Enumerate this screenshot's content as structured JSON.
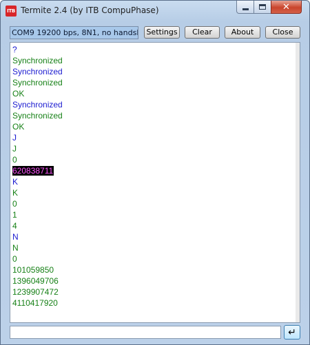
{
  "window": {
    "title": "Termite 2.4 (by ITB CompuPhase)",
    "icon_text": "ITB"
  },
  "titlebar_buttons": {
    "minimize_icon": "minimize-icon",
    "maximize_icon": "maximize-icon",
    "close_icon": "close-icon",
    "close_glyph": "✕"
  },
  "toolbar": {
    "port_status": "COM9 19200 bps, 8N1, no handshake",
    "settings_label": "Settings",
    "clear_label": "Clear",
    "about_label": "About",
    "close_label": "Close"
  },
  "colors": {
    "green": "#168016",
    "blue": "#1a1ad0",
    "highlight_bg": "#000000",
    "highlight_fg": "#ff55ff"
  },
  "output": {
    "lines": [
      {
        "text": "?",
        "color": "blue"
      },
      {
        "text": "Synchronized",
        "color": "green"
      },
      {
        "text": "Synchronized",
        "color": "blue"
      },
      {
        "text": "Synchronized",
        "color": "green"
      },
      {
        "text": "OK",
        "color": "green"
      },
      {
        "text": "Synchronized",
        "color": "blue"
      },
      {
        "text": "Synchronized",
        "color": "green"
      },
      {
        "text": "OK",
        "color": "green"
      },
      {
        "text": "J",
        "color": "blue"
      },
      {
        "text": "J",
        "color": "green"
      },
      {
        "text": "0",
        "color": "green"
      },
      {
        "text": "620838711",
        "color": "highlight"
      },
      {
        "text": "K",
        "color": "blue"
      },
      {
        "text": "K",
        "color": "green"
      },
      {
        "text": "0",
        "color": "green"
      },
      {
        "text": "1",
        "color": "green"
      },
      {
        "text": "4",
        "color": "green"
      },
      {
        "text": "N",
        "color": "blue"
      },
      {
        "text": "N",
        "color": "green"
      },
      {
        "text": "0",
        "color": "green"
      },
      {
        "text": "101059850",
        "color": "green"
      },
      {
        "text": "1396049706",
        "color": "green"
      },
      {
        "text": "1239907472",
        "color": "green"
      },
      {
        "text": "4110417920",
        "color": "green"
      }
    ]
  },
  "input": {
    "value": "",
    "send_glyph": "↵",
    "send_icon": "enter-icon"
  }
}
